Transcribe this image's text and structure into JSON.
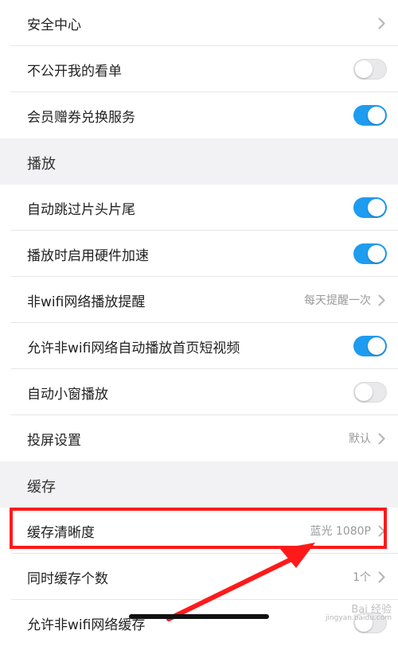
{
  "rows_top": [
    {
      "label": "安全中心",
      "kind": "chevron"
    },
    {
      "label": "不公开我的看单",
      "kind": "toggle",
      "on": false
    },
    {
      "label": "会员赠券兑换服务",
      "kind": "toggle",
      "on": true
    }
  ],
  "section_play": {
    "title": "播放"
  },
  "rows_play": [
    {
      "label": "自动跳过片头片尾",
      "kind": "toggle",
      "on": true
    },
    {
      "label": "播放时启用硬件加速",
      "kind": "toggle",
      "on": true
    },
    {
      "label": "非wifi网络播放提醒",
      "kind": "chevron",
      "value": "每天提醒一次"
    },
    {
      "label": "允许非wifi网络自动播放首页短视频",
      "kind": "toggle",
      "on": true
    },
    {
      "label": "自动小窗播放",
      "kind": "toggle",
      "on": false
    },
    {
      "label": "投屏设置",
      "kind": "chevron",
      "value": "默认"
    }
  ],
  "section_cache": {
    "title": "缓存"
  },
  "rows_cache": [
    {
      "label": "缓存清晰度",
      "kind": "chevron",
      "value": "蓝光 1080P"
    },
    {
      "label": "同时缓存个数",
      "kind": "chevron",
      "value": "1个"
    },
    {
      "label": "允许非wifi网络缓存",
      "kind": "toggle",
      "on": false
    }
  ],
  "watermark": {
    "line1": "Bai 经验",
    "line2": "jingyan.baidu.com"
  },
  "colors": {
    "accent": "#1e9cf0",
    "annotation": "#ff1a1a"
  }
}
